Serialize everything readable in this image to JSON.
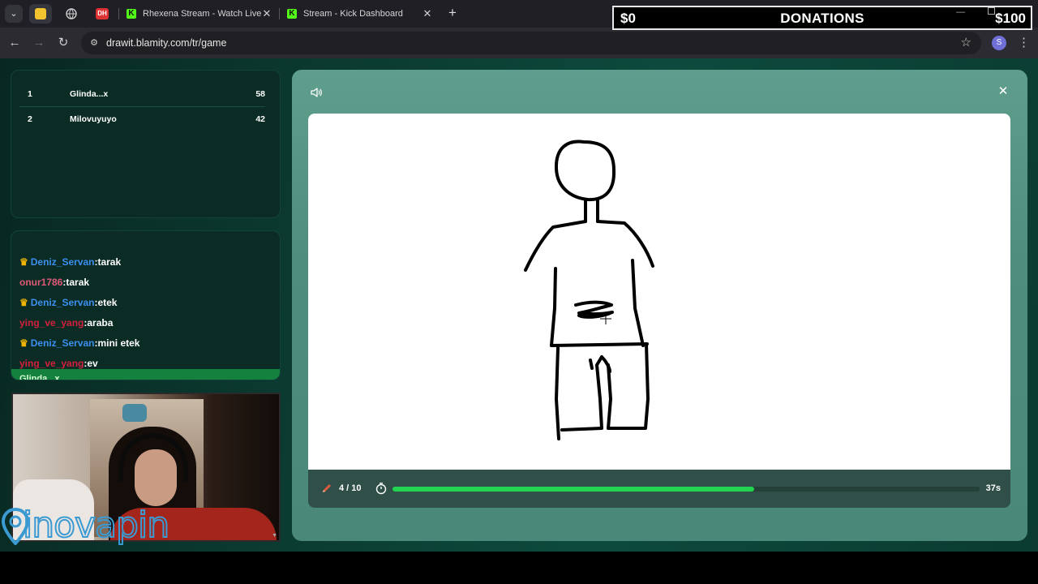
{
  "browser": {
    "tabs": [
      {
        "label": "Rhexena Stream - Watch Live o"
      },
      {
        "label": "Stream - Kick Dashboard"
      }
    ],
    "pinned": [
      "DH"
    ],
    "url": "drawit.blamity.com/tr/game",
    "profile_initial": "S"
  },
  "donations": {
    "left": "$0",
    "title": "DONATIONS",
    "right": "$100"
  },
  "leaderboard": [
    {
      "rank": "1",
      "name": "Glinda...x",
      "score": "58"
    },
    {
      "rank": "2",
      "name": "Milovuyuyo",
      "score": "42"
    }
  ],
  "chat": {
    "messages": [
      {
        "user": "Deniz_Servan",
        "text": ":tarak",
        "crown": true,
        "color": "#3b8ff0"
      },
      {
        "user": "onur1786",
        "text": ":tarak",
        "crown": false,
        "color": "#e05a78"
      },
      {
        "user": "Deniz_Servan",
        "text": ":etek",
        "crown": true,
        "color": "#3b8ff0"
      },
      {
        "user": "ying_ve_yang",
        "text": ":araba",
        "crown": false,
        "color": "#d61f3c"
      },
      {
        "user": "Deniz_Servan",
        "text": ":mini etek",
        "crown": true,
        "color": "#3b8ff0"
      },
      {
        "user": "ying_ve_yang",
        "text": ":ev",
        "crown": false,
        "color": "#d61f3c"
      }
    ],
    "highlight": "Glinda...x"
  },
  "game": {
    "round": "4 / 10",
    "time_left": "37s",
    "progress": 0.616
  },
  "watermark": "inovapin",
  "colors": {
    "accent_green": "#22d452",
    "kick_green": "#53fc18",
    "page_bg": "#0b3a30"
  }
}
